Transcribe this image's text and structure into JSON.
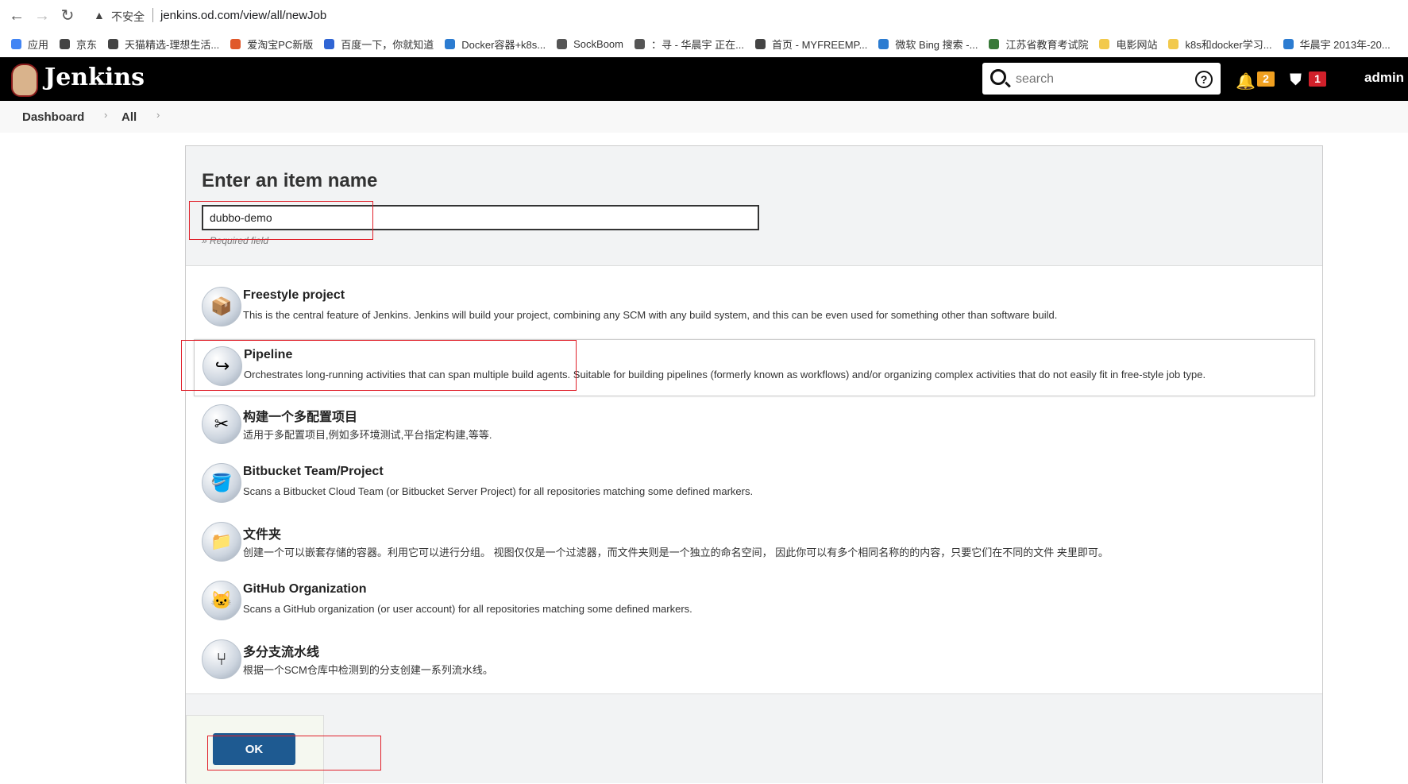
{
  "browser": {
    "security_label": "不安全",
    "url": "jenkins.od.com/view/all/newJob",
    "bookmarks": [
      {
        "label": "应用",
        "color": "#4285f4"
      },
      {
        "label": "京东",
        "color": "#444"
      },
      {
        "label": "天猫精选-理想生活...",
        "color": "#444"
      },
      {
        "label": "爱淘宝PC新版",
        "color": "#e0582a"
      },
      {
        "label": "百度一下，你就知道",
        "color": "#3065d4"
      },
      {
        "label": "Docker容器+k8s...",
        "color": "#2c7cd1"
      },
      {
        "label": "SockBoom",
        "color": "#555"
      },
      {
        "label": "：寻 - 华晨宇 正在...",
        "color": "#555"
      },
      {
        "label": "首页 - MYFREEMP...",
        "color": "#444"
      },
      {
        "label": "微软 Bing 搜索 -...",
        "color": "#2c7cd1"
      },
      {
        "label": "江苏省教育考试院",
        "color": "#3a7a3a"
      },
      {
        "label": "电影网站",
        "color": "#f2c94c"
      },
      {
        "label": "k8s和docker学习...",
        "color": "#f2c94c"
      },
      {
        "label": "华晨宇 2013年-20...",
        "color": "#2c7cd1"
      }
    ]
  },
  "header": {
    "app_name": "Jenkins",
    "search_placeholder": "search",
    "notifications_count": "2",
    "security_count": "1",
    "user": "admin"
  },
  "breadcrumb": [
    "Dashboard",
    "All"
  ],
  "form": {
    "title": "Enter an item name",
    "item_name": "dubbo-demo",
    "required_hint": "» Required field",
    "ok_label": "OK"
  },
  "item_types": [
    {
      "name": "Freestyle project",
      "desc": "This is the central feature of Jenkins. Jenkins will build your project, combining any SCM with any build system, and this can be even used for something other than software build.",
      "icon": "freestyle-icon",
      "glyph": "📦"
    },
    {
      "name": "Pipeline",
      "desc": "Orchestrates long-running activities that can span multiple build agents. Suitable for building pipelines (formerly known as workflows) and/or organizing complex activities that do not easily fit in free-style job type.",
      "icon": "pipeline-icon",
      "glyph": "↪"
    },
    {
      "name": "构建一个多配置项目",
      "desc": "适用于多配置项目,例如多环境测试,平台指定构建,等等.",
      "icon": "multi-config-icon",
      "glyph": "✂"
    },
    {
      "name": "Bitbucket Team/Project",
      "desc": "Scans a Bitbucket Cloud Team (or Bitbucket Server Project) for all repositories matching some defined markers.",
      "icon": "bitbucket-icon",
      "glyph": "🪣"
    },
    {
      "name": "文件夹",
      "desc": "创建一个可以嵌套存储的容器。利用它可以进行分组。 视图仅仅是一个过滤器，而文件夹则是一个独立的命名空间， 因此你可以有多个相同名称的的内容，只要它们在不同的文件 夹里即可。",
      "icon": "folder-icon",
      "glyph": "📁"
    },
    {
      "name": "GitHub Organization",
      "desc": "Scans a GitHub organization (or user account) for all repositories matching some defined markers.",
      "icon": "github-icon",
      "glyph": "🐱"
    },
    {
      "name": "多分支流水线",
      "desc": "根据一个SCM仓库中检测到的分支创建一系列流水线。",
      "icon": "multibranch-icon",
      "glyph": "⑂"
    }
  ]
}
